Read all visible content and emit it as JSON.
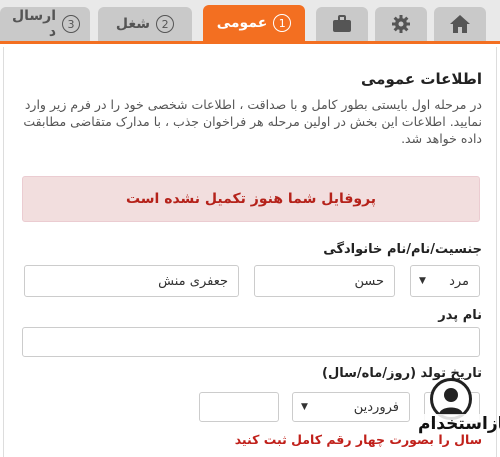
{
  "tabs": {
    "general_number": "1",
    "general_label": "عمومی",
    "job_number": "2",
    "job_label": "شغل",
    "send_number": "3",
    "send_label": "ارسال د",
    "home_icon": "home-icon",
    "settings_icon": "gear-icon",
    "briefcase_icon": "briefcase-icon"
  },
  "section": {
    "title": "اطلاعات عمومی",
    "description": "در مرحله اول بایستی بطور کامل و با صداقت ، اطلاعات شخصی خود را در فرم زیر وارد نمایید. اطلاعات این بخش در اولین مرحله هر فراخوان جذب ، با مدارک متقاضی مطابقت داده خواهد شد."
  },
  "alert": {
    "text": "پروفایل شما هنوز تکمیل نشده است"
  },
  "name_row": {
    "label": "جنسیت/نام/نام خانوادگی",
    "gender_value": "مرد",
    "first_name_value": "حسن",
    "last_name_value": "جعفری منش"
  },
  "father": {
    "label": "نام پدر",
    "value": ""
  },
  "birth": {
    "label": "تاریخ تولد (روز/ماه/سال)",
    "month_value": "فروردین",
    "year_value": "",
    "error": "سال را بصورت چهار رقم کامل ثبت کنید"
  },
  "watermark": {
    "text": "بازاستخدام"
  },
  "colors": {
    "accent": "#f36f21",
    "alert_bg": "#f2dede",
    "alert_text": "#b5221a"
  }
}
